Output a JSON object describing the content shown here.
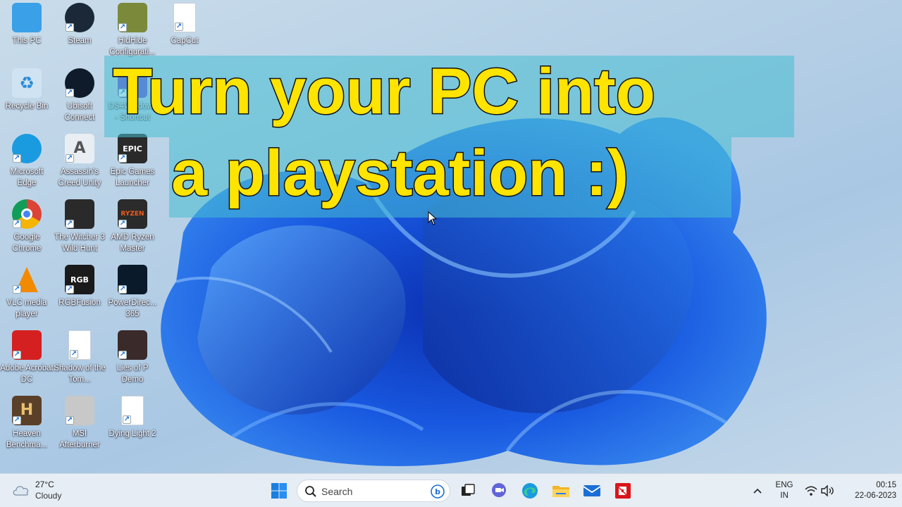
{
  "caption": {
    "line1": "Turn your PC into",
    "line2": "a playstation :)"
  },
  "desktop_icons": [
    {
      "label": "This PC",
      "icon": "monitor-icon",
      "color": "#3aa0e8",
      "glyph": "",
      "shortcut": false
    },
    {
      "label": "Steam",
      "icon": "steam-icon",
      "color": "#1b2838",
      "glyph": "",
      "shortcut": true
    },
    {
      "label": "HidHide Configurati...",
      "icon": "hidhide-icon",
      "color": "#7a8a3a",
      "glyph": "",
      "shortcut": true
    },
    {
      "label": "CapCut",
      "icon": "capcut-icon",
      "color": "#ffffff",
      "glyph": "",
      "shortcut": true
    },
    {
      "label": "Recycle Bin",
      "icon": "recycle-bin-icon",
      "color": "#cfe3f2",
      "glyph": "♻",
      "shortcut": false
    },
    {
      "label": "Ubisoft Connect",
      "icon": "ubisoft-icon",
      "color": "#0f1a2a",
      "glyph": "",
      "shortcut": true
    },
    {
      "label": "DS4Windows - Shortcut",
      "icon": "ds4windows-icon",
      "color": "#6b4fd8",
      "glyph": "",
      "shortcut": true
    },
    {
      "label": "Microsoft Edge",
      "icon": "edge-icon",
      "color": "#1a9be0",
      "glyph": "",
      "shortcut": true
    },
    {
      "label": "Assassin's Creed Unity",
      "icon": "assassins-creed-icon",
      "color": "#e8eef2",
      "glyph": "A",
      "shortcut": true
    },
    {
      "label": "Epic Games Launcher",
      "icon": "epic-games-icon",
      "color": "#2a2a2a",
      "glyph": "EPIC",
      "shortcut": true
    },
    {
      "label": "Google Chrome",
      "icon": "chrome-icon",
      "color": "#e8e8e8",
      "glyph": "",
      "shortcut": true
    },
    {
      "label": "The Witcher 3 Wild Hunt",
      "icon": "witcher-icon",
      "color": "#2a2a2a",
      "glyph": "",
      "shortcut": true
    },
    {
      "label": "AMD Ryzen Master",
      "icon": "ryzen-master-icon",
      "color": "#2b2b2b",
      "glyph": "RYZEN",
      "shortcut": true
    },
    {
      "label": "VLC media player",
      "icon": "vlc-icon",
      "color": "transparent",
      "glyph": "",
      "shortcut": true
    },
    {
      "label": "RGBFusion",
      "icon": "rgbfusion-icon",
      "color": "#1a1a1a",
      "glyph": "RGB",
      "shortcut": true
    },
    {
      "label": "PowerDirec... 365",
      "icon": "powerdirector-icon",
      "color": "#0a1a2a",
      "glyph": "",
      "shortcut": true
    },
    {
      "label": "Adobe Acrobat DC",
      "icon": "acrobat-icon",
      "color": "#d42020",
      "glyph": "",
      "shortcut": true
    },
    {
      "label": "Shadow of the Tom...",
      "icon": "blank-file-icon",
      "color": "#ffffff",
      "glyph": "",
      "shortcut": true
    },
    {
      "label": "Lies of P Demo",
      "icon": "lies-of-p-icon",
      "color": "#3a2a2a",
      "glyph": "",
      "shortcut": true
    },
    {
      "label": "Heaven Benchma...",
      "icon": "heaven-benchmark-icon",
      "color": "#5a4028",
      "glyph": "H",
      "shortcut": true
    },
    {
      "label": "MSI Afterburner",
      "icon": "msi-afterburner-icon",
      "color": "#c8c8c8",
      "glyph": "",
      "shortcut": true
    },
    {
      "label": "Dying Light 2",
      "icon": "blank-file-icon",
      "color": "#ffffff",
      "glyph": "",
      "shortcut": true
    }
  ],
  "taskbar": {
    "weather_temp": "27°C",
    "weather_condition": "Cloudy",
    "search_placeholder": "Search",
    "language_line1": "ENG",
    "language_line2": "IN",
    "clock_time": "00:15",
    "clock_date": "22-06-2023"
  }
}
